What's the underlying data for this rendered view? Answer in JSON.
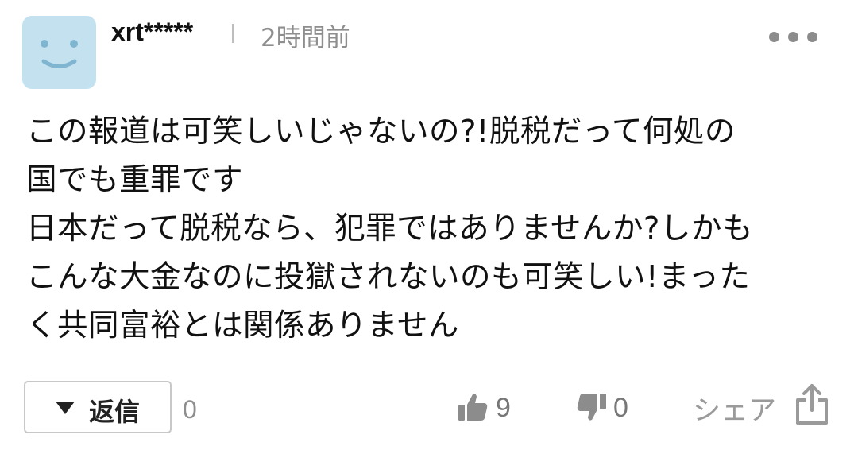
{
  "user": {
    "name": "xrt*****",
    "time": "2時間前",
    "avatar_icon": "smiley-face-icon"
  },
  "comment": {
    "text": "この報道は可笑しいじゃないの?!脱税だって何処の\n国でも重罪です\n日本だって脱税なら、犯罪ではありませんか?しかも\nこんな大金なのに投獄されないのも可笑しい!まった\nく共同富裕とは関係ありません"
  },
  "actions": {
    "reply_label": "返信",
    "reply_count": "0",
    "like_count": "9",
    "dislike_count": "0",
    "share_label": "シェア"
  },
  "colors": {
    "avatar_bg": "#c4e1ef",
    "avatar_face": "#7fb5d0",
    "muted_text": "#8e8e8e",
    "icon_gray": "#8c8c8c"
  }
}
